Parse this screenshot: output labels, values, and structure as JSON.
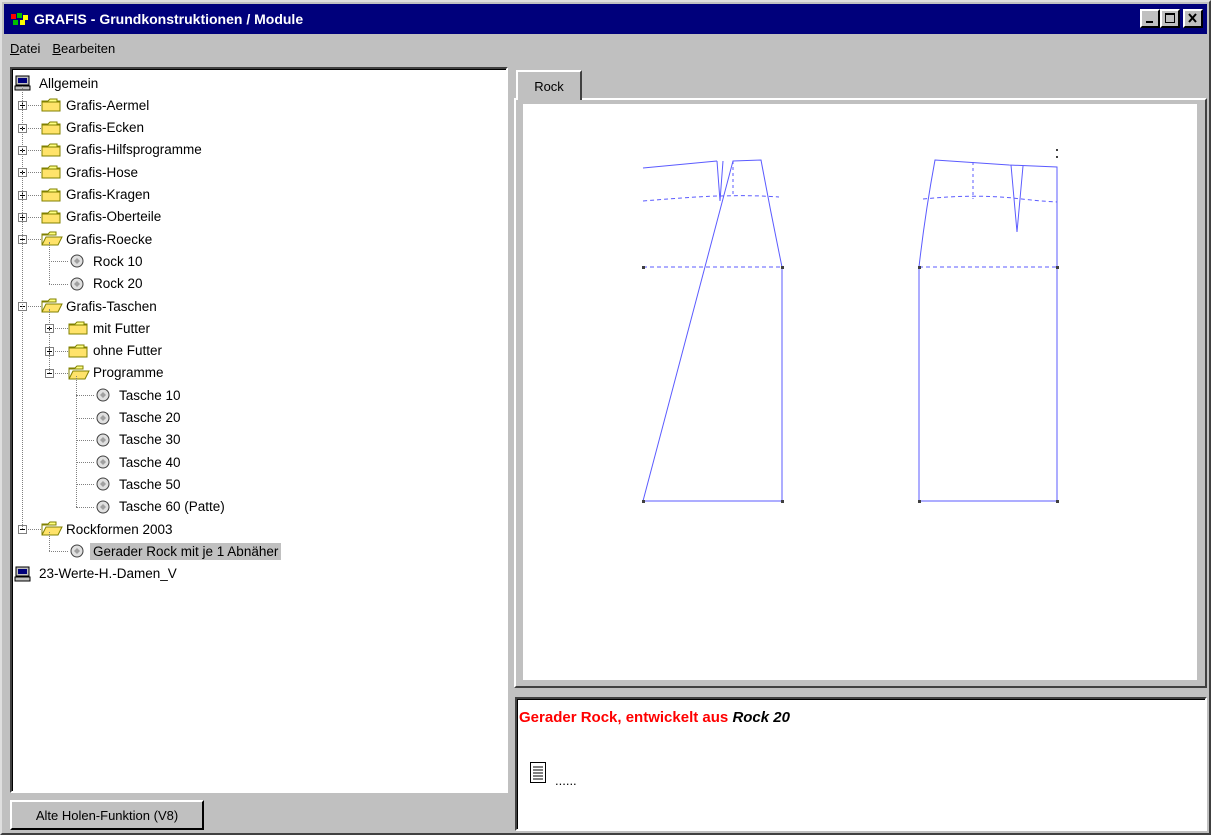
{
  "window": {
    "title": "GRAFIS - Grundkonstruktionen / Module"
  },
  "menu": [
    {
      "label": "Datei"
    },
    {
      "label": "Bearbeiten"
    }
  ],
  "tree": [
    {
      "label": "Allgemein",
      "icon": "computer-icon"
    },
    {
      "label": "Grafis-Aermel",
      "icon": "folder-icon"
    },
    {
      "label": "Grafis-Ecken",
      "icon": "folder-icon"
    },
    {
      "label": "Grafis-Hilfsprogramme",
      "icon": "folder-icon"
    },
    {
      "label": "Grafis-Hose",
      "icon": "folder-icon"
    },
    {
      "label": "Grafis-Kragen",
      "icon": "folder-icon"
    },
    {
      "label": "Grafis-Oberteile",
      "icon": "folder-icon"
    },
    {
      "label": "Grafis-Roecke",
      "icon": "folder-open-icon"
    },
    {
      "label": "Rock 10",
      "icon": "module-icon"
    },
    {
      "label": "Rock 20",
      "icon": "module-icon"
    },
    {
      "label": "Grafis-Taschen",
      "icon": "folder-open-icon"
    },
    {
      "label": "mit Futter",
      "icon": "folder-icon"
    },
    {
      "label": "ohne Futter",
      "icon": "folder-icon"
    },
    {
      "label": "Programme",
      "icon": "folder-open-icon"
    },
    {
      "label": "Tasche 10",
      "icon": "module-icon"
    },
    {
      "label": "Tasche 20",
      "icon": "module-icon"
    },
    {
      "label": "Tasche 30",
      "icon": "module-icon"
    },
    {
      "label": "Tasche 40",
      "icon": "module-icon"
    },
    {
      "label": "Tasche 50",
      "icon": "module-icon"
    },
    {
      "label": "Tasche 60 (Patte)",
      "icon": "module-icon"
    },
    {
      "label": "Rockformen 2003",
      "icon": "folder-open-icon"
    },
    {
      "label": "Gerader Rock mit je 1 Abnäher",
      "icon": "module-icon",
      "selected": true
    },
    {
      "label": "23-Werte-H.-Damen_V",
      "icon": "computer-icon"
    }
  ],
  "bottom_button": {
    "label": "Alte Holen-Funktion (V8)"
  },
  "tabs": [
    {
      "label": "Rock"
    }
  ],
  "info": {
    "title_red": "Gerader Rock, entwickelt aus",
    "title_italic": "Rock 20",
    "dots": "......"
  },
  "colors": {
    "titlebar": "#00007b",
    "pattern_line": "#5b5bff",
    "info_title": "#ff0000"
  }
}
